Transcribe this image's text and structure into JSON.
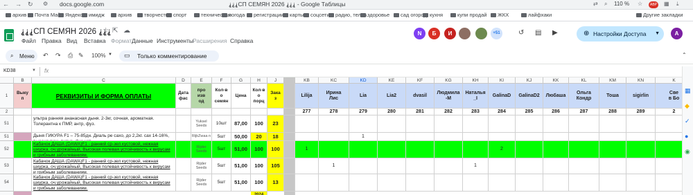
{
  "browser": {
    "url": "docs.google.com",
    "tab_title": "⸘⸘⸘СП СЕМЯН 2026 ⸘⸘⸘ - Google Таблицы",
    "zoom": "110 %",
    "profile_badge": "ABP"
  },
  "bookmarks": [
    {
      "label": "архив"
    },
    {
      "label": "Почта Mail"
    },
    {
      "label": "Яндекс"
    },
    {
      "label": "имидж"
    },
    {
      "label": "архив"
    },
    {
      "label": "творчество"
    },
    {
      "label": "спорт"
    },
    {
      "label": "техническая"
    },
    {
      "label": "погода"
    },
    {
      "label": "регистрации"
    },
    {
      "label": "карты"
    },
    {
      "label": "соцсети"
    },
    {
      "label": "радио, телев."
    },
    {
      "label": "здоровье"
    },
    {
      "label": "сад огород"
    },
    {
      "label": "кухня"
    },
    {
      "label": "купи продай"
    },
    {
      "label": "ЖКХ"
    },
    {
      "label": "лайфхаки"
    },
    {
      "label": "Другие закладки"
    }
  ],
  "doc": {
    "title": "⸘⸘⸘СП СЕМЯН 2026 ⸘⸘⸘",
    "menu": [
      "Файл",
      "Правка",
      "Вид",
      "Вставка",
      "Формат",
      "Данные",
      "Инструменты",
      "Расширения",
      "Справка"
    ],
    "avatars": [
      {
        "letter": "N",
        "color": "#7e3ff2"
      },
      {
        "letter": "Б",
        "color": "#d93025"
      },
      {
        "letter": "И",
        "color": "#c5221f"
      },
      {
        "letter": "",
        "color": "#8d6e63"
      },
      {
        "letter": "",
        "color": "#6d8a4e"
      },
      {
        "letter": "+51",
        "color": "#8ab4f8"
      }
    ],
    "share_label": "Настройки Доступа",
    "user_initial": "A"
  },
  "toolbar": {
    "menu_label": "Меню",
    "zoom": "100%",
    "mode_label": "Только комментирование"
  },
  "formula_bar": {
    "cell_ref": "KD38",
    "fx": "fx",
    "value": ""
  },
  "sheet": {
    "col_headers": [
      "A",
      "B",
      "C",
      "D",
      "E",
      "F",
      "G",
      "H",
      "J",
      "KB",
      "KC",
      "KD",
      "KE",
      "KF",
      "KG",
      "KH",
      "KI",
      "KJ",
      "KK",
      "KL",
      "KM",
      "KN",
      "K"
    ],
    "header_row": {
      "row_num": "1",
      "b": "Выку\nп",
      "c": "РЕКВИЗИТЫ И ФОРМА ОПЛАТЫ",
      "d": "Дата\nфас",
      "e": "про\nизв\nод",
      "f": "Кол-в\nо\nсемян",
      "g": "Цена",
      "h": "Кол-в\nо\nпорц",
      "j": "Зака\nз",
      "names": [
        "Lilija",
        "Ирина\nЛис",
        "Lia",
        "Lia2",
        "dvasil",
        "Людмила\n-M",
        "Наталья\n_I",
        "GalinaD",
        "GalinaD2",
        "Любаша",
        "Ольга\nКондр",
        "Тоша",
        "sigirlin",
        "Све\nв Бо"
      ]
    },
    "row2": {
      "row_num": "2",
      "nums": [
        "277",
        "278",
        "279",
        "280",
        "281",
        "282",
        "283",
        "284",
        "285",
        "286",
        "287",
        "288",
        "289",
        "2"
      ]
    },
    "rows": [
      {
        "row_num": "51",
        "desc": "ультра ранняя ананасная дыня. 2-3кг, сочная, ароматная. Толерантна к ПМР, антр, фуз.",
        "producer": "Yuksel Seeds",
        "qty": "10шт",
        "price": "87,00",
        "portions": "100",
        "order": "23",
        "marks": [
          "",
          "",
          "",
          "",
          "",
          "",
          "",
          "",
          "",
          "",
          "",
          "",
          "",
          ""
        ]
      },
      {
        "row_num": "51",
        "desc": "Дыня ГИКУРА F1 – 75-85дн. Диаль ре сахо, до 2,2кг. сах 14-16%, высокоурож. вирус, фуз уст",
        "producer": "RijkZwaa n",
        "qty": "5шт",
        "price": "50,00",
        "portions": "20",
        "order": "18",
        "marks": [
          "",
          "",
          "1",
          "",
          "",
          "",
          "",
          "",
          "",
          "",
          "",
          "",
          "",
          ""
        ]
      },
      {
        "row_num": "52",
        "desc": "Кабачок ДАША (DAWA)F1 - ранний ср-зел кустовой, нежная шкурка, оч.урожайный, Высокая полевая устойчивость к вирусам и грибным заболеваниям.",
        "producer": "Rijder Seeds",
        "qty": "5шт",
        "price": "51,00",
        "portions": "100",
        "order": "100",
        "marks": [
          "1",
          "",
          "",
          "",
          "",
          "",
          "",
          "2",
          "",
          "",
          "",
          "",
          "",
          ""
        ]
      },
      {
        "row_num": "53",
        "desc": "Кабачок ДАША (DAWA)F1 - ранний ср-зел кустовой, нежная шкурка, оч.урожайный, Высокая полевая устойчивость к вирусам и грибным заболеваниям.",
        "producer": "Rijder Seeds",
        "qty": "5шт",
        "price": "51,00",
        "portions": "100",
        "order": "105",
        "marks": [
          "",
          "1",
          "",
          "",
          "",
          "",
          "1",
          "",
          "",
          "",
          "",
          "",
          "",
          ""
        ]
      },
      {
        "row_num": "54",
        "desc": "Кабачок ДАША (DAWA)F1 - ранний ср-зел кустовой, нежная шкурка, оч.урожайный, Высокая полевая устойчивость к вирусам и грибным заболеваниям.",
        "producer": "Rijder Seeds",
        "qty": "5шт",
        "price": "51,00",
        "portions": "100",
        "order": "13",
        "marks": [
          "",
          "",
          "",
          "",
          "",
          "",
          "",
          "",
          "",
          "",
          "",
          "",
          "",
          ""
        ]
      }
    ],
    "partial_row": {
      "h": "2024"
    }
  }
}
